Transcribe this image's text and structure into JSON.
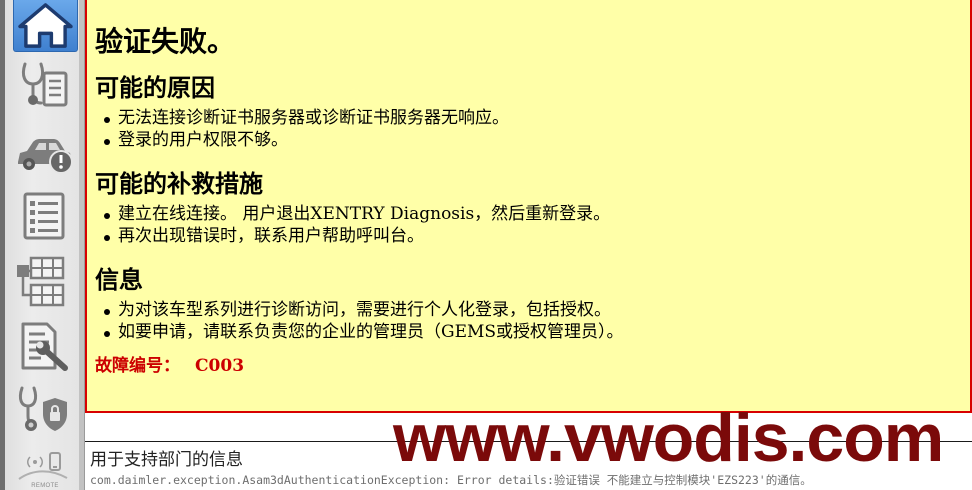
{
  "colors": {
    "panel_background": "#ffffa8",
    "panel_border": "#d80000",
    "error_code_text": "#cc0000",
    "sidebar_active_button": "#4a8ad6",
    "sidebar_icon": "#7d7d7d",
    "watermark_text": "#7b0a0a"
  },
  "sidebar": {
    "icons": [
      "home-icon",
      "stethoscope-list-icon",
      "car-warning-icon",
      "list-document-icon",
      "tree-diagram-icon",
      "document-wrench-icon",
      "stethoscope-shield-icon",
      "remote-icon"
    ],
    "active_icon": "home-icon",
    "remote_label": "REMOTE"
  },
  "message": {
    "title": "验证失败。",
    "sections": [
      {
        "heading": "可能的原因",
        "bullets": [
          "无法连接诊断证书服务器或诊断证书服务器无响应。",
          "登录的用户权限不够。"
        ]
      },
      {
        "heading": "可能的补救措施",
        "bullets": [
          "建立在线连接。 用户退出XENTRY Diagnosis，然后重新登录。",
          "再次出现错误时，联系用户帮助呼叫台。"
        ]
      },
      {
        "heading": "信息",
        "bullets": [
          "为对该车型系列进行诊断访问，需要进行个人化登录，包括授权。",
          "如要申请，请联系负责您的企业的管理员（GEMS或授权管理员）。"
        ]
      }
    ],
    "error_code_label": "故障编号：",
    "error_code": "C003"
  },
  "support": {
    "heading": "用于支持部门的信息",
    "details": "com.daimler.exception.Asam3dAuthenticationException: Error details:验证错误 不能建立与控制模块'EZS223'的通信。"
  },
  "watermark": {
    "text": "www.vwodis.com"
  }
}
